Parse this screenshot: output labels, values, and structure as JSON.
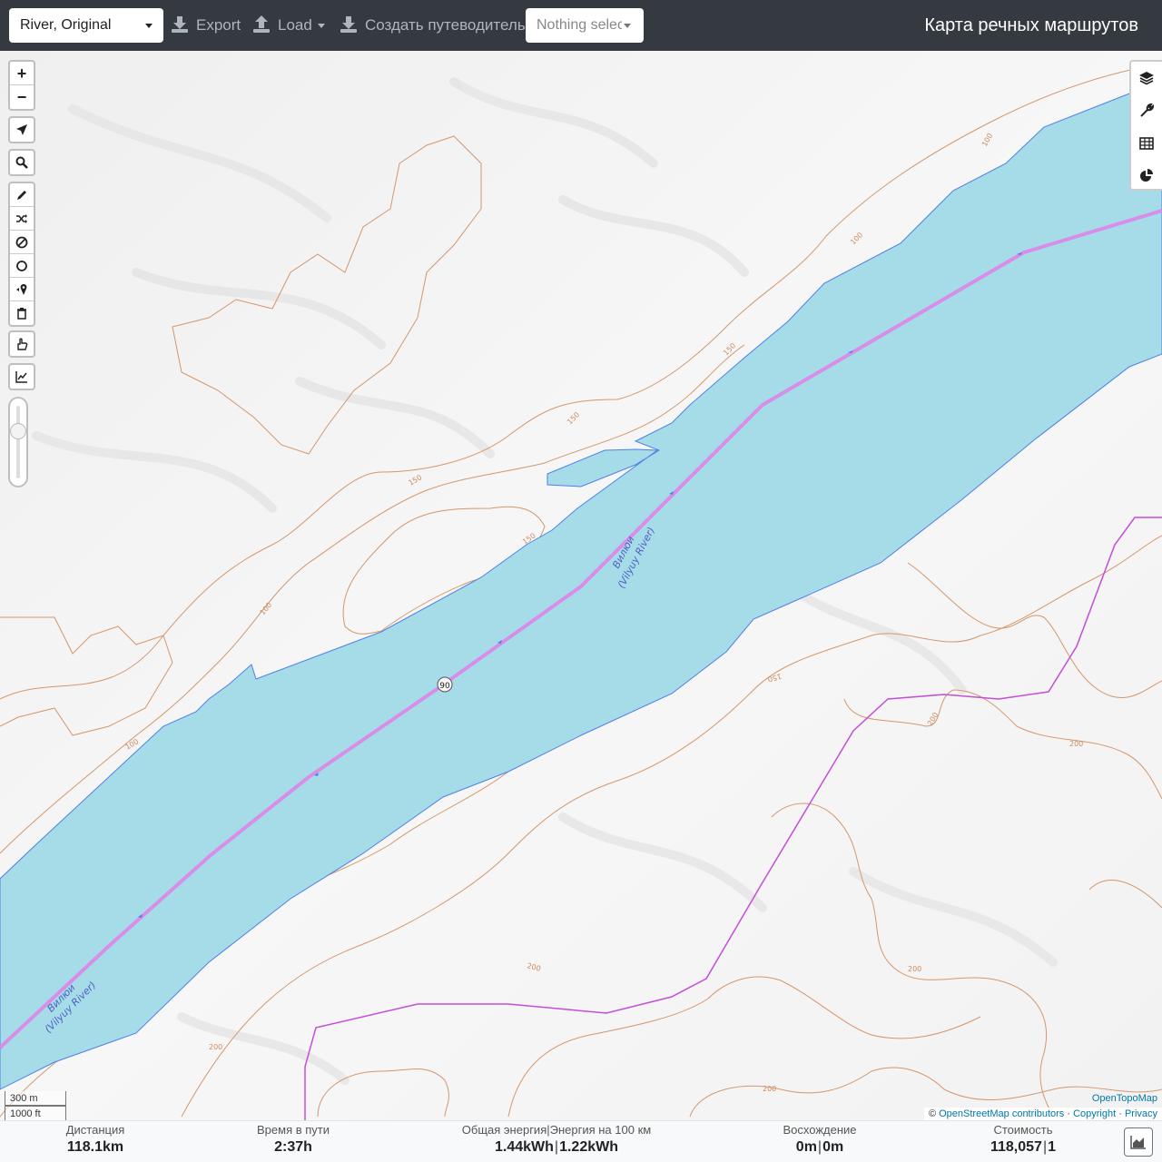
{
  "topbar": {
    "profile": "River, Original",
    "export_label": "Export",
    "load_label": "Load",
    "guide_label": "Создать путеводитель",
    "selection_placeholder": "Nothing selected",
    "app_title": "Карта речных маршрутов"
  },
  "map": {
    "river_label_1_line1": "Вилюи",
    "river_label_1_line2": "(Vilyuy River)",
    "river_label_2_line1": "Вилюи",
    "river_label_2_line2": "(Vilyuy River)",
    "route_marker": "90",
    "contours": [
      "100",
      "100",
      "100",
      "100",
      "150",
      "150",
      "150",
      "150",
      "150",
      "200",
      "200",
      "200",
      "200",
      "200",
      "200"
    ],
    "scale_metric": "300 m",
    "scale_imperial": "1000 ft",
    "attribution_provider": "OpenTopoMap",
    "attribution_osm": "OpenStreetMap contributors",
    "attribution_copyright": "Copyright",
    "attribution_privacy": "Privacy",
    "colors": {
      "water": "#a6dce8",
      "route": "#d88ee8",
      "boundary": "#c44ed8",
      "contour": "#d4976b"
    }
  },
  "controls": {
    "left": [
      "zoom-in",
      "zoom-out",
      "locate",
      "search",
      "draw",
      "reroute",
      "no-go-area",
      "circle",
      "poi",
      "delete",
      "profile",
      "elevation-chart",
      "opacity-slider"
    ],
    "right": [
      "layers",
      "tools",
      "table",
      "statistics"
    ],
    "zoom_in_label": "+",
    "zoom_out_label": "−"
  },
  "stats": {
    "distance_label": "Дистанция",
    "distance_value": "118.1",
    "distance_unit": "km",
    "time_label": "Время в пути",
    "time_value": "2:37",
    "time_unit": "h",
    "energy_label": "Общая энергия|Энергия на 100 км",
    "energy_value": "1.44",
    "energy_unit": "kWh",
    "energy_per100_value": "1.22",
    "energy_per100_unit": "kWh",
    "ascent_label": "Восхождение",
    "ascent_value": "0",
    "ascent_unit": "m",
    "descent_value": "0",
    "descent_unit": "m",
    "cost_label": "Стоимость",
    "cost_value": "118,057",
    "cost_secondary": "1"
  }
}
